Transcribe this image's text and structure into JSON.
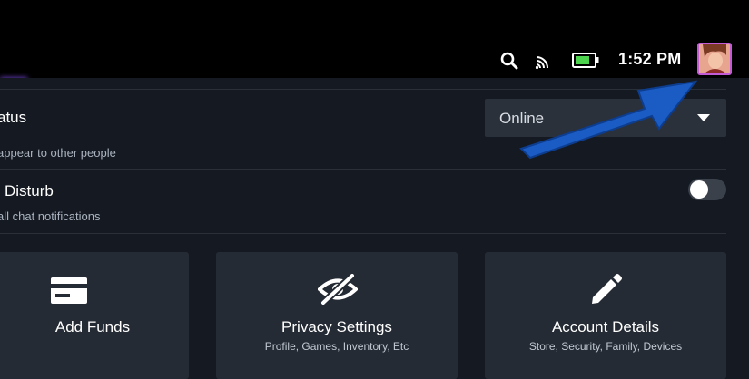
{
  "topbar": {
    "clock": "1:52 PM",
    "icons": [
      "search-icon",
      "cast-icon",
      "battery-icon"
    ],
    "battery_level": 0.8
  },
  "status_row": {
    "title": "atus",
    "subtitle": "appear to other people",
    "select_value": "Online"
  },
  "dnd_row": {
    "title": "Disturb",
    "subtitle": "all chat notifications",
    "enabled": false
  },
  "cards": [
    {
      "title": "Add Funds",
      "subtitle": "",
      "icon": "credit-card-icon"
    },
    {
      "title": "Privacy Settings",
      "subtitle": "Profile, Games, Inventory, Etc",
      "icon": "eye-off-icon"
    },
    {
      "title": "Account Details",
      "subtitle": "Store, Security, Family, Devices",
      "icon": "pencil-icon"
    }
  ],
  "colors": {
    "topbar": "#000000",
    "background": "#151a22",
    "card": "#252b34",
    "select": "#2a313b",
    "battery": "#4dd34d",
    "arrow": "#1a5bc4",
    "avatar_border": "#c35bd6"
  }
}
